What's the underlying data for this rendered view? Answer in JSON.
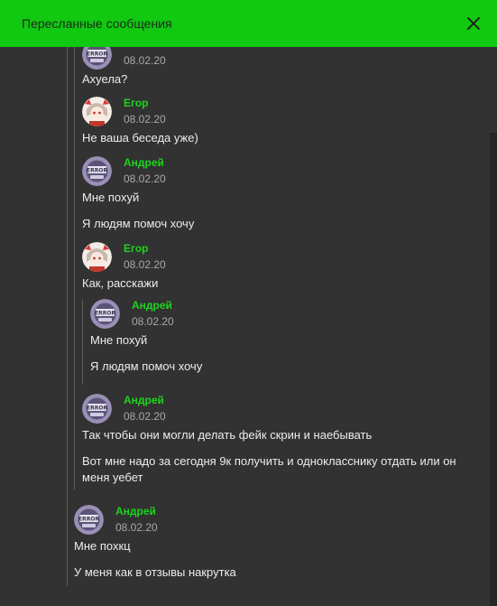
{
  "header": {
    "title": "Пересланные сообщения",
    "close_icon": "close-icon"
  },
  "colors": {
    "header_bg": "#10c910",
    "author": "#1fd21f",
    "panel": "#323232"
  },
  "messages": [
    {
      "author": "Андрей",
      "date": "08.02.20",
      "lines": [
        "Ахуела?"
      ]
    },
    {
      "author": "Егор",
      "date": "08.02.20",
      "lines": [
        "Не ваша беседа уже)"
      ]
    },
    {
      "author": "Андрей",
      "date": "08.02.20",
      "lines": [
        "Мне похуй",
        "Я людям помоч хочу"
      ]
    },
    {
      "author": "Егор",
      "date": "08.02.20",
      "lines": [
        "Как, расскажи"
      ]
    },
    {
      "author": "Андрей",
      "date": "08.02.20",
      "lines": [
        "Мне похуй",
        "Я людям помоч хочу"
      ]
    },
    {
      "author": "Андрей",
      "date": "08.02.20",
      "lines": [
        "Так чтобы они могли делать фейк скрин и наебывать",
        "Вот мне надо за сегодня 9к получить и однокласснику отдать или он меня уебет"
      ]
    },
    {
      "author": "Андрей",
      "date": "08.02.20",
      "lines": [
        "Мне похкц",
        "У меня как в отзывы накрутка"
      ]
    }
  ],
  "avatars": {
    "andrey": "error-sticker-avatar",
    "egor": "anime-girl-avatar"
  }
}
